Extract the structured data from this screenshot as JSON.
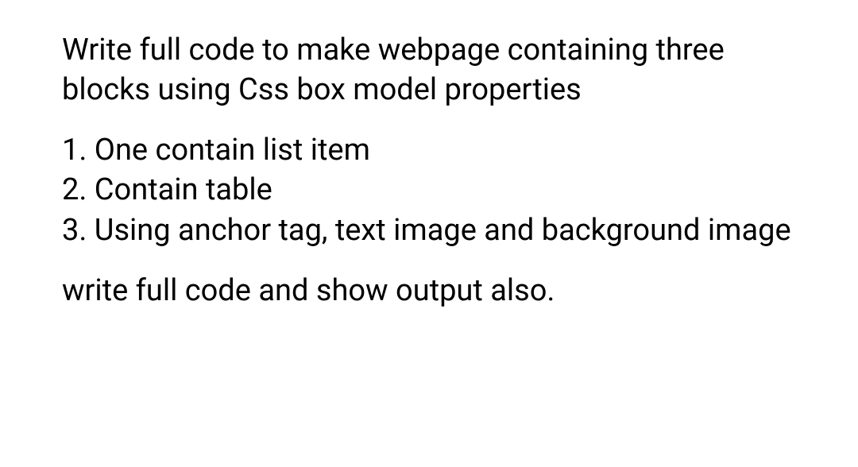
{
  "intro": "Write full code to make webpage containing three blocks using Css box model properties",
  "items": [
    "1. One contain list item",
    "2. Contain table",
    "3. Using anchor tag, text image and background image"
  ],
  "outro": "write full code and show output also."
}
